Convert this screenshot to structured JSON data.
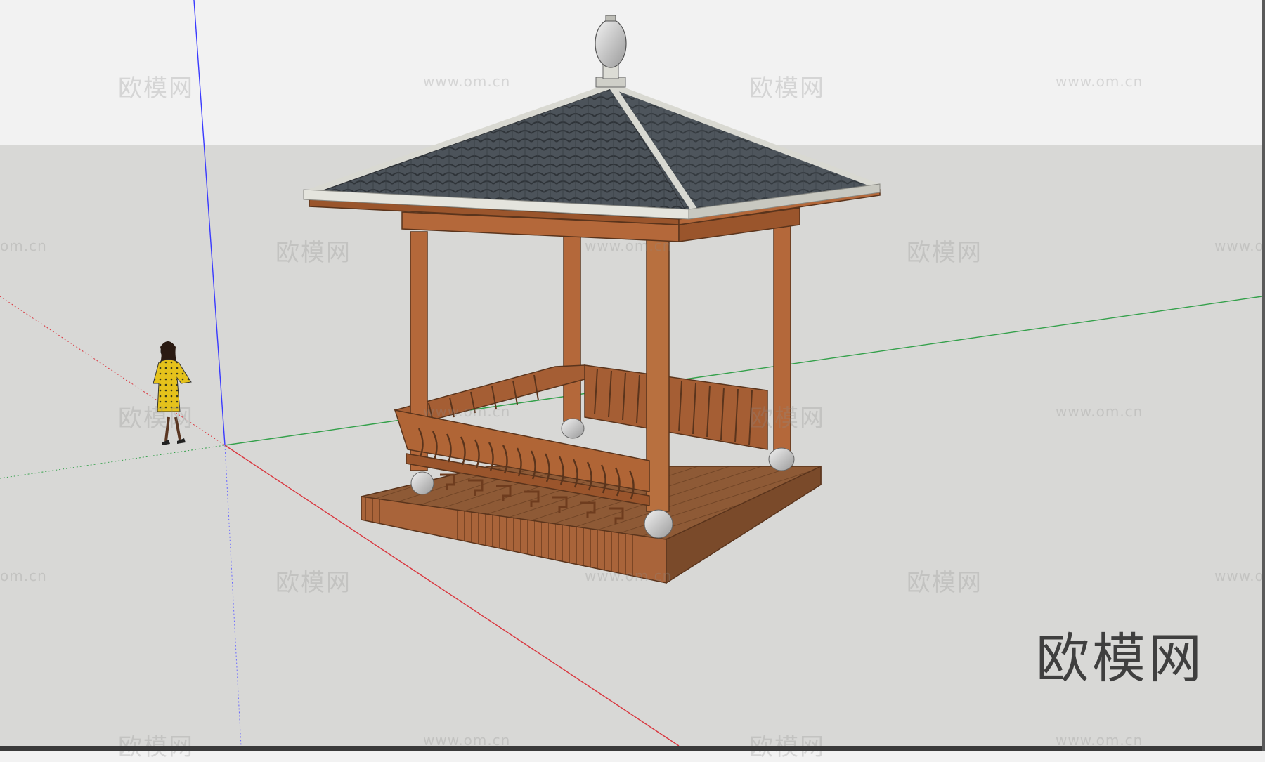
{
  "app": {
    "name": "SketchUp viewport"
  },
  "scene": {
    "sky_color": "#f2f2f2",
    "ground_color": "#d8d8d6",
    "axis_colors": {
      "red": "#d9363e",
      "green": "#33a04a",
      "blue": "#3a3aff"
    },
    "model": "square wooden pavilion with tiled hip roof",
    "figure": "person in yellow dress",
    "roof_color": "#4a5056",
    "wood_color": "#b4683a"
  },
  "watermarks": {
    "cn": "欧模网",
    "url": "www.om.cn",
    "partial_url": "om.cn",
    "partial_url_right": "www.o"
  },
  "brand": {
    "text": "欧模网"
  }
}
